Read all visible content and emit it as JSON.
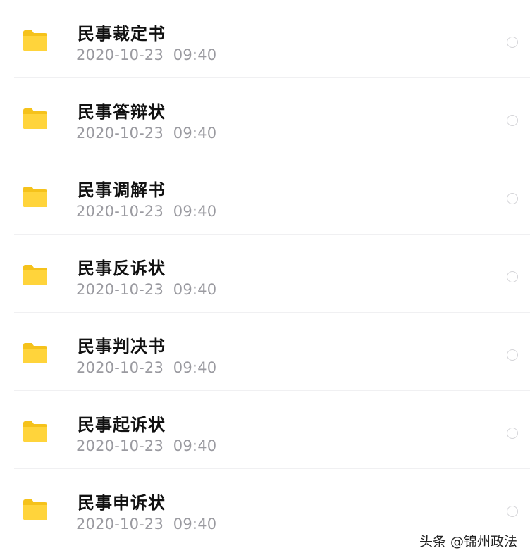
{
  "colors": {
    "folder": "#FFD43B",
    "folder_tab": "#F5C21B",
    "title_text": "#111111",
    "date_text": "#9A9AA0",
    "radio_border": "#D4D4D8"
  },
  "icons": {
    "item": "folder-icon",
    "select": "radio-circle-icon"
  },
  "files": [
    {
      "name": "民事裁定书",
      "date": "2020-10-23  09:40"
    },
    {
      "name": "民事答辩状",
      "date": "2020-10-23  09:40"
    },
    {
      "name": "民事调解书",
      "date": "2020-10-23  09:40"
    },
    {
      "name": "民事反诉状",
      "date": "2020-10-23  09:40"
    },
    {
      "name": "民事判决书",
      "date": "2020-10-23  09:40"
    },
    {
      "name": "民事起诉状",
      "date": "2020-10-23  09:40"
    },
    {
      "name": "民事申诉状",
      "date": "2020-10-23  09:40"
    }
  ],
  "watermark": "头条 @锦州政法"
}
